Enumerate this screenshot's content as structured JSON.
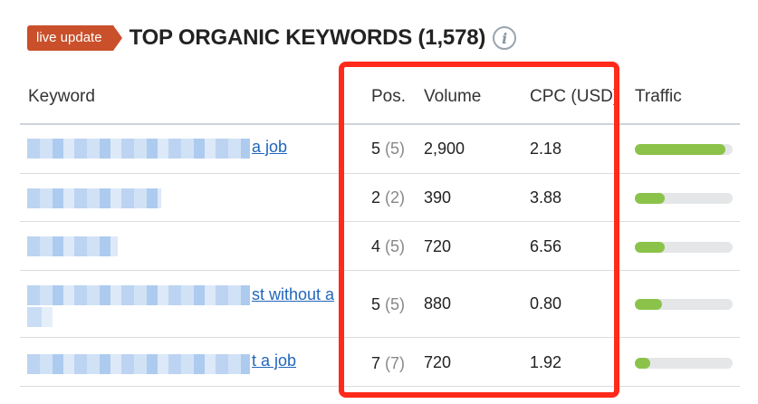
{
  "header": {
    "badge": "live update",
    "title": "TOP ORGANIC KEYWORDS (1,578)",
    "info_icon": "info-icon"
  },
  "table": {
    "columns": [
      "Keyword",
      "Pos.",
      "Volume",
      "CPC (USD)",
      "Traffic"
    ],
    "rows": [
      {
        "keyword_visible": "a job",
        "pos": "5",
        "prev_pos": "(5)",
        "volume": "2,900",
        "cpc": "2.18",
        "traffic_fraction": 0.93
      },
      {
        "keyword_visible": "",
        "pos": "2",
        "prev_pos": "(2)",
        "volume": "390",
        "cpc": "3.88",
        "traffic_fraction": 0.31
      },
      {
        "keyword_visible": "",
        "pos": "4",
        "prev_pos": "(5)",
        "volume": "720",
        "cpc": "6.56",
        "traffic_fraction": 0.31
      },
      {
        "keyword_visible": "st without a",
        "pos": "5",
        "prev_pos": "(5)",
        "volume": "880",
        "cpc": "0.80",
        "traffic_fraction": 0.28
      },
      {
        "keyword_visible": "t a job",
        "pos": "7",
        "prev_pos": "(7)",
        "volume": "720",
        "cpc": "1.92",
        "traffic_fraction": 0.16
      }
    ]
  },
  "colors": {
    "badge": "#c9502b",
    "link": "#2266bb",
    "traffic_bar": "#8bc34a",
    "highlight": "#ff2a1a"
  }
}
